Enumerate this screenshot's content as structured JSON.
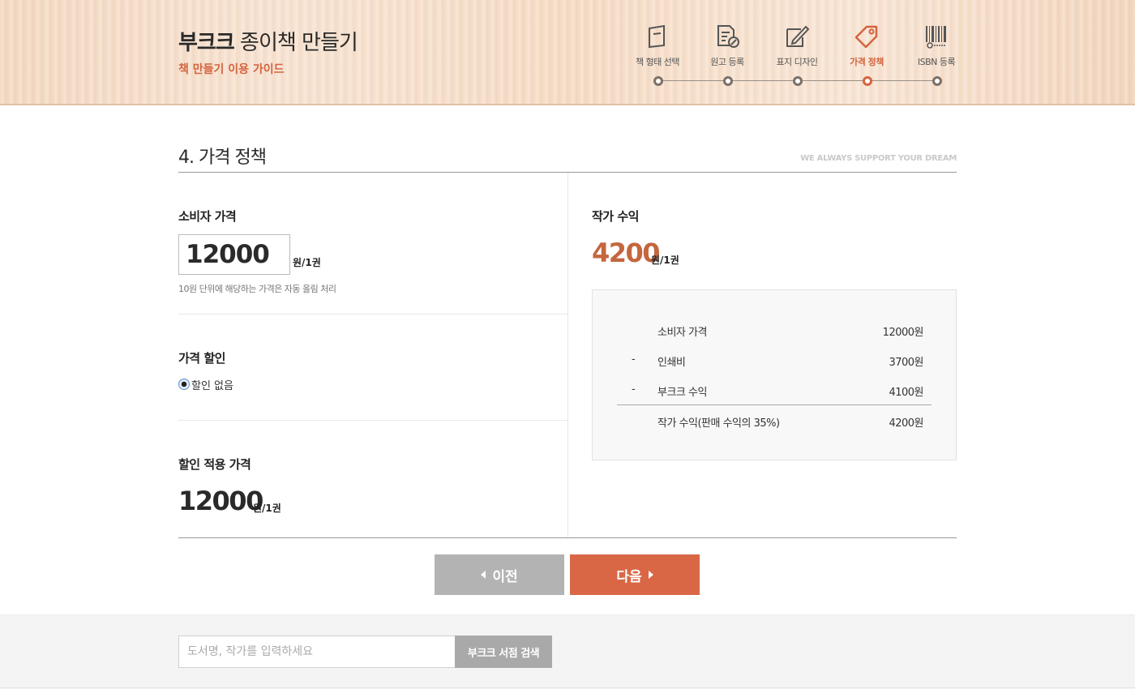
{
  "header": {
    "title_bold": "부크크",
    "title_light": " 종이책 만들기",
    "subtitle": "책 만들기 이용 가이드"
  },
  "steps": [
    {
      "label": "책 형태 선택",
      "icon": "book-icon",
      "active": false
    },
    {
      "label": "원고 등록",
      "icon": "document-edit-icon",
      "active": false
    },
    {
      "label": "표지 디자인",
      "icon": "pencil-square-icon",
      "active": false
    },
    {
      "label": "가격 정책",
      "icon": "price-tag-icon",
      "active": true
    },
    {
      "label": "ISBN 등록",
      "icon": "barcode-icon",
      "active": false
    }
  ],
  "colors": {
    "accent": "#d4643f",
    "next_button": "#d96746",
    "prev_button": "#b3b3b3",
    "author_amount": "#c4663e"
  },
  "main": {
    "section_title": "4. 가격 정책",
    "tagline": "WE ALWAYS SUPPORT YOUR DREAM",
    "consumer_price": {
      "label": "소비자 가격",
      "value": "12000",
      "unit": "원/1권",
      "note": "10원 단위에 해당하는 가격은 자동 올림 처리"
    },
    "discount": {
      "label": "가격 할인",
      "option": "할인 없음"
    },
    "discounted_price": {
      "label": "할인 적용 가격",
      "value": "12000",
      "unit": "원/1권"
    },
    "author_income": {
      "label": "작가 수익",
      "value": "4200",
      "unit": "원/1권"
    },
    "breakdown": [
      {
        "sign": "",
        "name": "소비자 가격",
        "amount": "12000원"
      },
      {
        "sign": "-",
        "name": "인쇄비",
        "amount": "3700원"
      },
      {
        "sign": "-",
        "name": "부크크 수익",
        "amount": "4100원"
      },
      {
        "sign": "",
        "name": "작가 수익(판매 수익의 35%)",
        "amount": "4200원"
      }
    ]
  },
  "buttons": {
    "prev": "이전",
    "next": "다음"
  },
  "footer": {
    "search_placeholder": "도서명, 작가를 입력하세요",
    "search_button": "부크크 서점 검색"
  }
}
